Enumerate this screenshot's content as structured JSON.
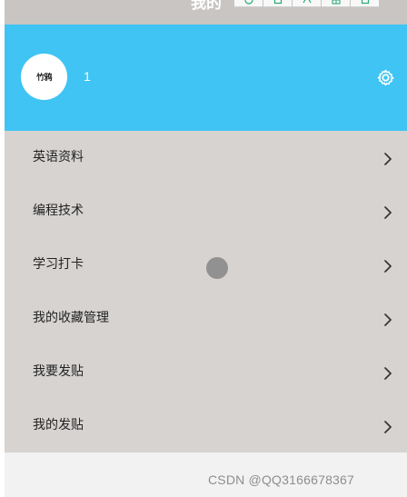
{
  "header": {
    "title": "我的",
    "toolbar_icons": [
      "toolbar-icon-1",
      "toolbar-icon-2",
      "toolbar-icon-3",
      "toolbar-icon-4",
      "toolbar-icon-5"
    ]
  },
  "profile": {
    "avatar_text": "竹鸦",
    "username": "1",
    "settings_icon": "gear-icon"
  },
  "menu": {
    "items": [
      {
        "label": "英语资料",
        "icon": "chevron-right-icon"
      },
      {
        "label": "编程技术",
        "icon": "chevron-right-icon"
      },
      {
        "label": "学习打卡",
        "icon": "chevron-right-icon"
      },
      {
        "label": "我的收藏管理",
        "icon": "chevron-right-icon"
      },
      {
        "label": "我要发贴",
        "icon": "chevron-right-icon"
      },
      {
        "label": "我的发贴",
        "icon": "chevron-right-icon"
      }
    ]
  },
  "footer": {
    "watermark": "CSDN @QQ3166678367"
  },
  "colors": {
    "accent": "#3fc4f4",
    "menu_background": "#d6d3d1",
    "header_background": "#c9c5c3"
  }
}
